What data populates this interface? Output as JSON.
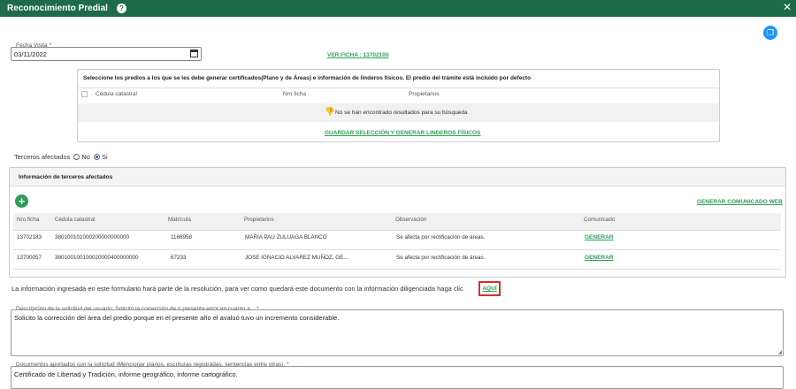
{
  "window": {
    "title": "Reconocimiento Predial",
    "help_icon": "question-circle-icon",
    "close_icon": "close-icon"
  },
  "visit": {
    "label": "Fecha Visita",
    "required": "*",
    "value": "03/11/2022"
  },
  "ver_ficha": "VER FICHA : 13702100",
  "predios": {
    "header": "Seleccione los predios a los que se les debe generar certificados(Plano y de Áreas) e información de linderos físicos. El predio del trámite está incluido por defecto",
    "columns": [
      "Cédula catastral",
      "Nro ficha",
      "Propietarios"
    ],
    "empty_message": "No se han encontrado resultados para su búsqueda",
    "save_link": "GUARDAR SELECCIÓN Y GENERAR LINDEROS FÍSICOS"
  },
  "terceros": {
    "label": "Terceros afectados",
    "option_no": "No",
    "option_si": "Si",
    "selected": "Si"
  },
  "terceros_info": {
    "header": "Información de terceros afectados",
    "generar_web": "GENERAR COMUNICADO WEB",
    "columns": [
      "Nro ficha",
      "Cédula catastral",
      "Matrícula",
      "Propietarios",
      "Observación",
      "Comunicado"
    ],
    "rows": [
      {
        "ficha": "13702183",
        "cedula": "380100101000200000000000",
        "matricula": "1166958",
        "propietarios": "MARIA PAU ZULUAGA BLANCO",
        "observacion": "Se afecta por rectificación de áreas.",
        "comunicado": "GENERAR"
      },
      {
        "ficha": "13700057",
        "cedula": "380100100100020000400000000",
        "matricula": "67233",
        "propietarios": "JOSE IGNACIO ALVAREZ MUÑOZ, GE...",
        "observacion": "Se afecta por rectificación de áreas.",
        "comunicado": "GENERAR"
      }
    ]
  },
  "info_note": {
    "text": "La información ingresada en este formulario hará parte de la resolución, para ver como quedará este documento con la información diligenciada haga clic",
    "link": "AQUÍ"
  },
  "descripcion": {
    "label": "Descripción de la solicitud del usuario: Solicitó la corrección de ó presenta error en cuanto a...",
    "required": "*",
    "value": "Solicito la corrección del área del predio porque en el presente año el avaluó tuvo un incremento considerable."
  },
  "documentos": {
    "label": "Documentos aportados con la solicitud (Mencionar planos, escrituras registradas, sentencias entre otras).",
    "required": "*",
    "value": "Certificado de Libertad y Tradición, informe geográfico, informe cartográfico."
  }
}
